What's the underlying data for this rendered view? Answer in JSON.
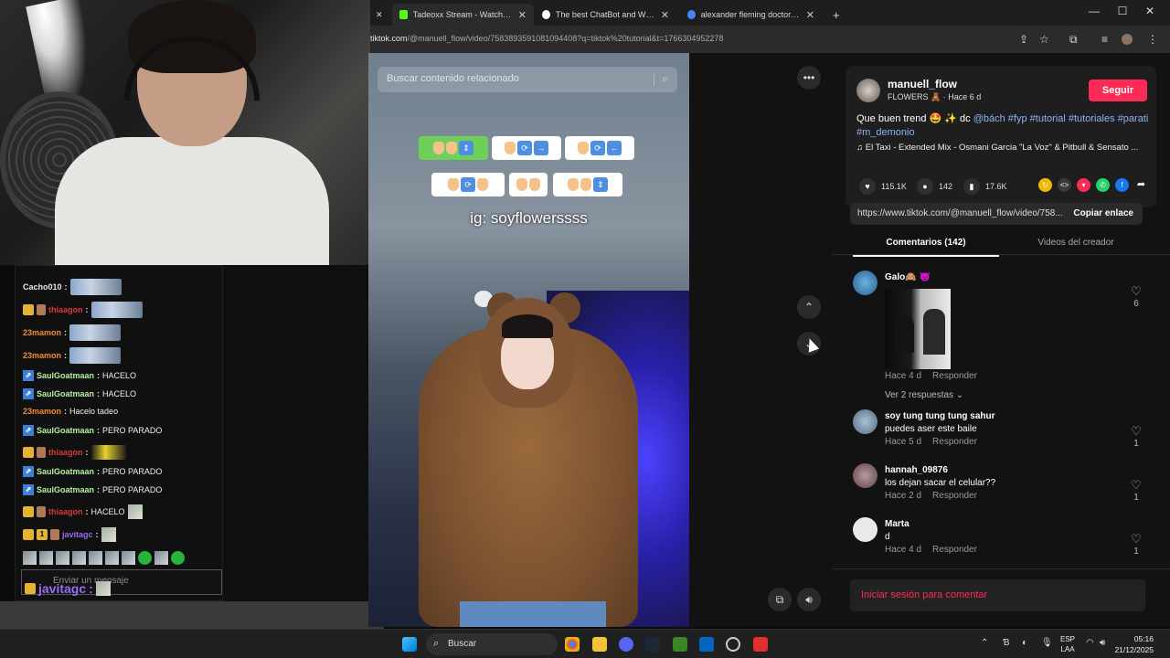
{
  "browser": {
    "tabs": [
      {
        "title": "Tadeoxx Stream - Watch Live o",
        "icon_color": "#53fc18"
      },
      {
        "title": "The best ChatBot and Widgets",
        "icon_color": "#ffffff"
      },
      {
        "title": "alexander fleming doctor - Busc",
        "icon_color": "#4285f4"
      }
    ],
    "new_tab": "+",
    "url_prefix": "tiktok.com",
    "url_rest": "/@manuell_flow/video/7583893591081094408?q=tiktok%20tutorial&t=1766304952278",
    "window_controls": [
      "—",
      "☐",
      "✕"
    ]
  },
  "chat": {
    "messages": [
      {
        "user": "Cacho010",
        "user_color": "#e6e6e6",
        "badges": [],
        "text": "",
        "emote": "wide"
      },
      {
        "user": "thiaagon",
        "user_color": "#d63a3a",
        "badges": [
          "gold",
          "face"
        ],
        "text": "",
        "emote": "wide"
      },
      {
        "user": "23mamon",
        "user_color": "#f28b30",
        "badges": [],
        "text": "",
        "emote": "wide"
      },
      {
        "user": "23mamon",
        "user_color": "#f28b30",
        "badges": [],
        "text": "",
        "emote": "wide"
      },
      {
        "user": "SaulGoatmaan",
        "user_color": "#b7f0a3",
        "badges": [
          "blue"
        ],
        "text": "HACELO",
        "emote": ""
      },
      {
        "user": "SaulGoatmaan",
        "user_color": "#b7f0a3",
        "badges": [
          "blue"
        ],
        "text": "HACELO",
        "emote": ""
      },
      {
        "user": "23mamon",
        "user_color": "#f28b30",
        "badges": [],
        "text": "Hacelo tadeo",
        "emote": ""
      },
      {
        "user": "SaulGoatmaan",
        "user_color": "#b7f0a3",
        "badges": [
          "blue"
        ],
        "text": "PERO PARADO",
        "emote": ""
      },
      {
        "user": "thiaagon",
        "user_color": "#d63a3a",
        "badges": [
          "gold",
          "face"
        ],
        "text": "",
        "emote": "car"
      },
      {
        "user": "SaulGoatmaan",
        "user_color": "#b7f0a3",
        "badges": [
          "blue"
        ],
        "text": "PERO PARADO",
        "emote": ""
      },
      {
        "user": "SaulGoatmaan",
        "user_color": "#b7f0a3",
        "badges": [
          "blue"
        ],
        "text": "PERO PARADO",
        "emote": ""
      },
      {
        "user": "thiaagon",
        "user_color": "#d63a3a",
        "badges": [
          "gold",
          "face"
        ],
        "text": "HACELO",
        "emote": "small"
      },
      {
        "user": "javitagc",
        "user_color": "#9b6cf2",
        "badges": [
          "gold",
          "one",
          "face"
        ],
        "text": "",
        "emote": "small"
      }
    ],
    "input_placeholder": "Enviar un mensaje",
    "overlay_user": "javitagc"
  },
  "video": {
    "search_placeholder": "Buscar contenido relacionado",
    "caption": "ig: soyflowerssss"
  },
  "creator": {
    "username": "manuell_flow",
    "subtitle": "FLOWERS 🧸 · Hace 6 d",
    "follow_label": "Seguir",
    "description": "Que buen trend 🤩 ✨ dc",
    "tags": [
      "@bách",
      "#fyp",
      "#tutorial",
      "#tutoriales",
      "#parati",
      "#m_demonio"
    ],
    "music": "♫  El Taxi - Extended Mix - Osmani Garcia \"La Voz\" & Pitbull & Sensato ...",
    "likes": "115.1K",
    "comments": "142",
    "saves": "17.6K",
    "link": "https://www.tiktok.com/@manuell_flow/video/758...",
    "copy_label": "Copiar enlace"
  },
  "tabs": {
    "comments": "Comentarios (142)",
    "creator_videos": "Videos del creador"
  },
  "comments": [
    {
      "name": "Galo🙈 😈",
      "text": "",
      "time": "Hace 4 d",
      "reply": "Responder",
      "likes": "6",
      "replies": "Ver 2 respuestas ⌄"
    },
    {
      "name": "soy tung tung tung sahur",
      "text": "puedes aser este baile",
      "time": "Hace 5 d",
      "reply": "Responder",
      "likes": "1"
    },
    {
      "name": "hannah_09876",
      "text": "los dejan sacar el celular??",
      "time": "Hace 2 d",
      "reply": "Responder",
      "likes": "1"
    },
    {
      "name": "Marta",
      "text": "d",
      "time": "Hace 4 d",
      "reply": "Responder",
      "likes": "1"
    }
  ],
  "login_prompt": "Iniciar sesión para comentar",
  "taskbar": {
    "search_label": "Buscar",
    "lang_top": "ESP",
    "lang_bottom": "LAA",
    "time": "05:16",
    "date": "21/12/2025"
  }
}
